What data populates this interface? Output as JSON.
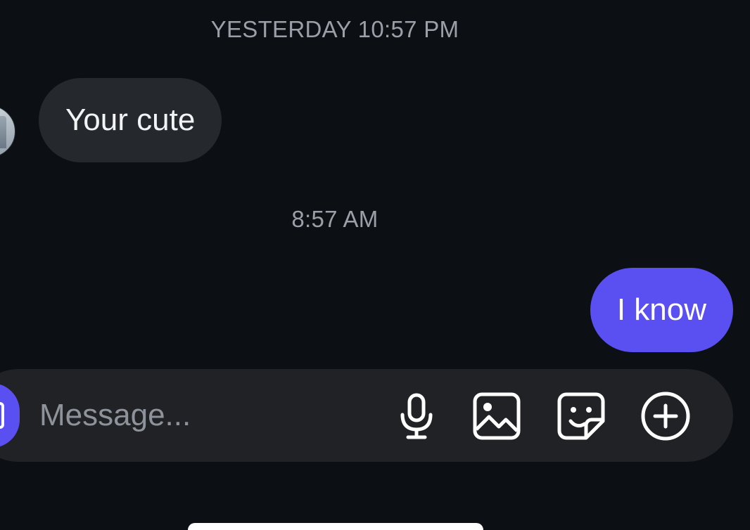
{
  "conversation": {
    "timestamp_yesterday": "YESTERDAY 10:57 PM",
    "timestamp_today": "8:57 AM",
    "incoming_message": "Your cute",
    "outgoing_message": "I know"
  },
  "composer": {
    "placeholder": "Message...",
    "icons": [
      "camera-icon",
      "microphone-icon",
      "gallery-icon",
      "sticker-icon",
      "plus-icon"
    ]
  },
  "colors": {
    "background": "#0c0f14",
    "incoming_bubble": "#25282d",
    "outgoing_bubble": "#5a4ff0",
    "composer": "#202225",
    "timestamp_text": "#9ba0a8"
  }
}
